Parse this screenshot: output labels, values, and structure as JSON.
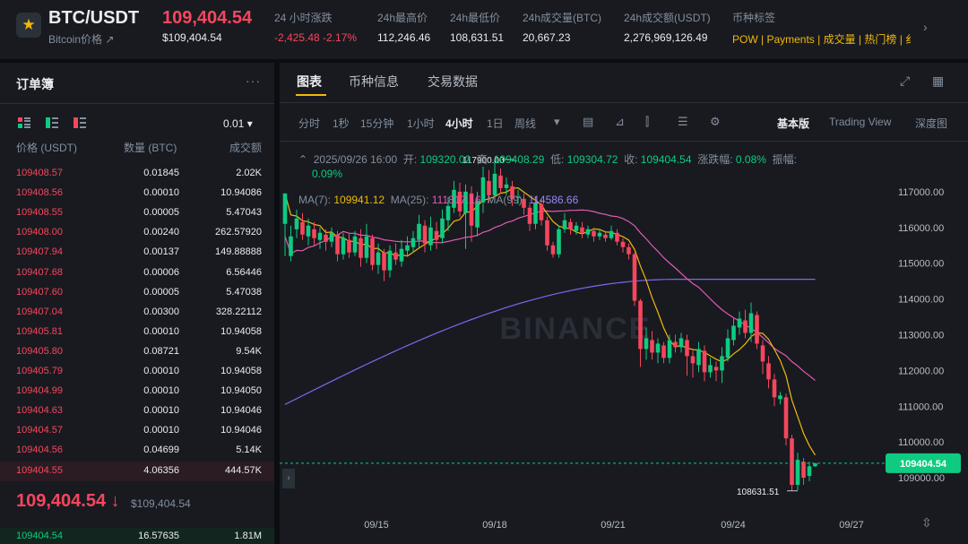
{
  "header": {
    "pair": "BTC/USDT",
    "subtitle": "Bitcoin价格 ↗",
    "last_price": "109,404.54",
    "last_price_usd": "$109,404.54",
    "stats": [
      {
        "label": "24 小时涨跌",
        "value": "-2,425.48 -2.17%",
        "color": "#f6465d"
      },
      {
        "label": "24h最高价",
        "value": "112,246.46",
        "color": "#eaecef"
      },
      {
        "label": "24h最低价",
        "value": "108,631.51",
        "color": "#eaecef"
      },
      {
        "label": "24h成交量(BTC)",
        "value": "20,667.23",
        "color": "#eaecef"
      },
      {
        "label": "24h成交额(USDT)",
        "value": "2,276,969,126.49",
        "color": "#eaecef"
      },
      {
        "label": "币种标签",
        "value": "",
        "color": "#eaecef"
      }
    ],
    "tags": "POW | Payments | 成交量 | 热门榜 | 纟"
  },
  "orderbook": {
    "title": "订单簿",
    "precision": "0.01 ▾",
    "col_price": "价格 (USDT)",
    "col_qty": "数量 (BTC)",
    "col_total": "成交额",
    "asks": [
      {
        "price": "109408.57",
        "qty": "0.01845",
        "total": "2.02K"
      },
      {
        "price": "109408.56",
        "qty": "0.00010",
        "total": "10.94086"
      },
      {
        "price": "109408.55",
        "qty": "0.00005",
        "total": "5.47043"
      },
      {
        "price": "109408.00",
        "qty": "0.00240",
        "total": "262.57920"
      },
      {
        "price": "109407.94",
        "qty": "0.00137",
        "total": "149.88888"
      },
      {
        "price": "109407.68",
        "qty": "0.00006",
        "total": "6.56446"
      },
      {
        "price": "109407.60",
        "qty": "0.00005",
        "total": "5.47038"
      },
      {
        "price": "109407.04",
        "qty": "0.00300",
        "total": "328.22112"
      },
      {
        "price": "109405.81",
        "qty": "0.00010",
        "total": "10.94058"
      },
      {
        "price": "109405.80",
        "qty": "0.08721",
        "total": "9.54K"
      },
      {
        "price": "109405.79",
        "qty": "0.00010",
        "total": "10.94058"
      },
      {
        "price": "109404.99",
        "qty": "0.00010",
        "total": "10.94050"
      },
      {
        "price": "109404.63",
        "qty": "0.00010",
        "total": "10.94046"
      },
      {
        "price": "109404.57",
        "qty": "0.00010",
        "total": "10.94046"
      },
      {
        "price": "109404.56",
        "qty": "0.04699",
        "total": "5.14K"
      },
      {
        "price": "109404.55",
        "qty": "4.06356",
        "total": "444.57K"
      }
    ],
    "mid_price": "109,404.54 ↓",
    "mid_price_usd": "$109,404.54",
    "bid": {
      "price": "109404.54",
      "qty": "16.57635",
      "total": "1.81M"
    }
  },
  "chart_panel": {
    "tabs": [
      "图表",
      "币种信息",
      "交易数据"
    ],
    "timeframes": [
      "分时",
      "1秒",
      "15分钟",
      "1小时",
      "4小时",
      "1日",
      "周线"
    ],
    "active_timeframe": "4小时",
    "views": [
      "基本版",
      "Trading View",
      "深度图"
    ],
    "active_view": "基本版",
    "ohlc": {
      "date": "2025/09/26 16:00",
      "open_label": "开:",
      "open": "109320.02",
      "high_label": "高:",
      "high": "109408.29",
      "low_label": "低:",
      "low": "109304.72",
      "close_label": "收:",
      "close": "109404.54",
      "change_label": "涨跌幅:",
      "change": "0.08%",
      "amp_label": "振幅:",
      "amp": "0.09%"
    },
    "ma": {
      "ma7": "MA(7):",
      "ma7_val": "109941.12",
      "ma25": "MA(25):",
      "ma25_val": "111817.16",
      "ma99": "MA(99):",
      "ma99_val": "114586.66"
    }
  },
  "chart_data": {
    "type": "candlestick",
    "y_range": [
      108500,
      118300
    ],
    "y_ticks": [
      "117000.00",
      "116000.00",
      "115000.00",
      "114000.00",
      "113000.00",
      "112000.00",
      "111000.00",
      "110000.00",
      "109000.00"
    ],
    "x_ticks": [
      "09/15",
      "09/18",
      "09/21",
      "09/24",
      "09/27"
    ],
    "current_price_label": "109404.54",
    "max_label": "117900.00",
    "min_label": "108631.51",
    "colors": {
      "up": "#0ecb81",
      "down": "#f6465d",
      "ma7": "#f0b90b",
      "ma25": "#e45ab4",
      "ma99": "#7b68ee"
    },
    "watermark": "BINANCE",
    "candles": [
      [
        116100,
        116950,
        116250,
        115200
      ],
      [
        115200,
        115750,
        116050,
        115050
      ],
      [
        115950,
        116250,
        116500,
        115700
      ],
      [
        116150,
        115800,
        116400,
        115650
      ],
      [
        115750,
        116050,
        116250,
        115500
      ],
      [
        115950,
        115700,
        116150,
        115500
      ],
      [
        115650,
        115850,
        116000,
        115400
      ],
      [
        115800,
        115600,
        115950,
        115350
      ],
      [
        115600,
        115850,
        116000,
        115450
      ],
      [
        115800,
        115250,
        115900,
        115050
      ],
      [
        115250,
        115700,
        115850,
        115100
      ],
      [
        115650,
        115300,
        115850,
        115150
      ],
      [
        115300,
        115750,
        115900,
        115200
      ],
      [
        115700,
        115150,
        115950,
        114900
      ],
      [
        115150,
        115750,
        116100,
        115000
      ],
      [
        115700,
        114950,
        115800,
        114800
      ],
      [
        114950,
        115300,
        115550,
        114700
      ],
      [
        115300,
        114800,
        115400,
        114500
      ],
      [
        114800,
        115350,
        115500,
        114600
      ],
      [
        115300,
        115100,
        115550,
        114950
      ],
      [
        115050,
        115400,
        115650,
        114900
      ],
      [
        115350,
        115500,
        115750,
        115200
      ],
      [
        115450,
        115700,
        115900,
        115300
      ],
      [
        115650,
        116100,
        116350,
        115450
      ],
      [
        116050,
        115550,
        116200,
        115300
      ],
      [
        115500,
        116000,
        116300,
        115350
      ],
      [
        115900,
        115650,
        116150,
        115400
      ],
      [
        115700,
        116250,
        116500,
        115550
      ],
      [
        116200,
        116600,
        116850,
        115900
      ],
      [
        116550,
        117050,
        117300,
        116400
      ],
      [
        117000,
        116450,
        117250,
        116300
      ],
      [
        116400,
        117000,
        117200,
        115400
      ],
      [
        116950,
        116050,
        117150,
        115600
      ],
      [
        116000,
        116750,
        117000,
        115750
      ],
      [
        116700,
        117400,
        117700,
        116400
      ],
      [
        117300,
        116900,
        117600,
        116700
      ],
      [
        116900,
        117500,
        117900,
        116700
      ],
      [
        117450,
        117100,
        117650,
        116950
      ],
      [
        117100,
        117200,
        117400,
        116900
      ],
      [
        117150,
        116800,
        117300,
        116600
      ],
      [
        116850,
        116850,
        117050,
        116650
      ],
      [
        116800,
        116550,
        116950,
        116350
      ],
      [
        116550,
        116100,
        116650,
        115900
      ],
      [
        116100,
        116700,
        116850,
        115950
      ],
      [
        116650,
        116200,
        116800,
        116050
      ],
      [
        116200,
        115500,
        116300,
        115350
      ],
      [
        115500,
        115250,
        115600,
        115150
      ],
      [
        115250,
        115950,
        116050,
        115150
      ],
      [
        115950,
        116200,
        116400,
        115850
      ],
      [
        116150,
        115950,
        116250,
        115800
      ],
      [
        115900,
        116050,
        116150,
        115800
      ],
      [
        116000,
        115850,
        116150,
        115700
      ],
      [
        115800,
        115950,
        116050,
        115700
      ],
      [
        115900,
        115750,
        116000,
        115600
      ],
      [
        115750,
        115850,
        115950,
        115650
      ],
      [
        115800,
        115700,
        115900,
        115600
      ],
      [
        115700,
        115900,
        116050,
        115650
      ],
      [
        115850,
        115600,
        115950,
        115500
      ],
      [
        115600,
        115450,
        115700,
        115300
      ],
      [
        115450,
        115250,
        115550,
        115100
      ],
      [
        115250,
        113950,
        115300,
        113800
      ],
      [
        113950,
        112600,
        114000,
        112100
      ],
      [
        112600,
        112900,
        113200,
        112300
      ],
      [
        112850,
        112500,
        113100,
        112300
      ],
      [
        112500,
        112750,
        112900,
        112200
      ],
      [
        112700,
        112350,
        112800,
        112200
      ],
      [
        112350,
        112850,
        113000,
        112200
      ],
      [
        112800,
        112650,
        113000,
        112500
      ],
      [
        112650,
        112900,
        113050,
        112500
      ],
      [
        112850,
        112400,
        113000,
        111850
      ],
      [
        112400,
        112200,
        112550,
        111800
      ],
      [
        112150,
        112600,
        112800,
        111950
      ],
      [
        112550,
        111950,
        112700,
        111700
      ],
      [
        111950,
        112150,
        112350,
        111800
      ],
      [
        112100,
        112000,
        112250,
        111700
      ],
      [
        112000,
        112400,
        112650,
        111650
      ],
      [
        112350,
        112900,
        113150,
        112250
      ],
      [
        112850,
        113250,
        113450,
        112700
      ],
      [
        113200,
        113450,
        113650,
        113000
      ],
      [
        113400,
        113050,
        113700,
        112900
      ],
      [
        113050,
        113600,
        113900,
        112800
      ],
      [
        113550,
        112750,
        113650,
        112600
      ],
      [
        112700,
        112250,
        112850,
        111900
      ],
      [
        112200,
        111750,
        112400,
        111500
      ],
      [
        111750,
        111250,
        111900,
        111000
      ],
      [
        111200,
        111300,
        111400,
        111050
      ],
      [
        111250,
        110100,
        111350,
        109900
      ],
      [
        110100,
        108800,
        110200,
        108631
      ],
      [
        108800,
        109500,
        109700,
        108650
      ],
      [
        109450,
        109000,
        109550,
        108800
      ],
      [
        109050,
        109320,
        109450,
        108900
      ],
      [
        109320,
        109404,
        109408,
        109304
      ]
    ]
  }
}
